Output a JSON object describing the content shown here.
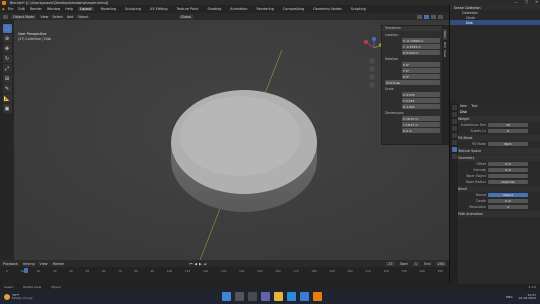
{
  "window": {
    "title": "Blender* [C:\\Users\\pravin\\Desktop\\blender\\sharper.blend]",
    "controls": [
      "—",
      "□",
      "✕"
    ]
  },
  "menu": {
    "items": [
      "File",
      "Edit",
      "Render",
      "Window",
      "Help"
    ]
  },
  "workspaces": {
    "tabs": [
      "Layout",
      "Modeling",
      "Sculpting",
      "UV Editing",
      "Texture Paint",
      "Shading",
      "Animation",
      "Rendering",
      "Compositing",
      "Geometry Nodes",
      "Scripting"
    ],
    "active": "Layout"
  },
  "scene": {
    "label": "Scene",
    "view_layer": "ViewLayer"
  },
  "header": {
    "mode": "Object Mode",
    "menus": [
      "View",
      "Select",
      "Add",
      "Object"
    ],
    "orientation": "Global"
  },
  "viewport": {
    "overlay_title": "User Perspective",
    "overlay_sub": "(27) Collection | Disk"
  },
  "npanel": {
    "title": "Transform",
    "location_label": "Location",
    "location": [
      "X  -0.74996 m",
      "Y  -0.0783 m",
      "Z  0.034 m"
    ],
    "rotation_label": "Rotation",
    "rotation": [
      "X  0°",
      "Y  0°",
      "Z  0°"
    ],
    "mode": "XYZ Euler",
    "scale_label": "Scale",
    "scale": [
      "X  9.235",
      "Y  9.235",
      "Z  3.095"
    ],
    "dimensions_label": "Dimensions",
    "dimensions": [
      "X  18.47 m",
      "Y  18.47 m",
      "Z  0 m"
    ],
    "tabs": [
      "Item",
      "Tool",
      "View"
    ]
  },
  "outliner": {
    "title": "Scene Collection",
    "rows": [
      {
        "label": "Collection",
        "selected": false
      },
      {
        "label": "Circle",
        "selected": false
      },
      {
        "label": "Disk",
        "selected": true
      }
    ]
  },
  "properties": {
    "object": "Disk",
    "tabs": [
      "Item",
      "Tool"
    ],
    "sections": [
      {
        "title": "Weight",
        "rows": [
          [
            "Subdivision Ren",
            "10"
          ],
          [
            "Subdiv Lv",
            "0"
          ]
        ]
      },
      {
        "title": "Fill Mode",
        "rows": [
          [
            "Fill Mode",
            "Both"
          ]
        ]
      },
      {
        "title": "Texture Space",
        "rows": []
      },
      {
        "title": "Geometry",
        "rows": [
          [
            "Offset",
            "0 m"
          ],
          [
            "Extrude",
            "0 m"
          ],
          [
            "Taper Object",
            ""
          ],
          [
            "Taper Radius",
            "Override"
          ]
        ]
      },
      {
        "title": "Bevel",
        "rows": [
          [
            "Round",
            "Object"
          ],
          [
            "Depth",
            "0 m"
          ],
          [
            "Resolution",
            "4"
          ]
        ]
      },
      {
        "title": "Path Animation",
        "rows": []
      }
    ]
  },
  "timeline": {
    "menus": [
      "Playback",
      "Keying",
      "View",
      "Marker"
    ],
    "frame_current": "27",
    "start_label": "Start",
    "start": "1",
    "end_label": "End",
    "end": "250",
    "ticks": [
      "0",
      "10",
      "20",
      "30",
      "40",
      "50",
      "60",
      "70",
      "80",
      "90",
      "100",
      "110",
      "120",
      "130",
      "140",
      "150",
      "160",
      "170",
      "180",
      "190",
      "200",
      "210",
      "220",
      "230",
      "240",
      "250"
    ]
  },
  "statusbar": {
    "left": "Select",
    "mid": "Rotate View",
    "right": "Object",
    "version": "3.1.0"
  },
  "taskbar": {
    "weather": "78°F",
    "weather_sub": "Mostly cloudy",
    "time": "15:27",
    "date": "01-05-2022",
    "lang": "ENG"
  },
  "colors": {
    "accent": "#4772b3",
    "viewport": "#3d3d3d",
    "panel": "#2e2e2e",
    "selected": "#334d80"
  }
}
